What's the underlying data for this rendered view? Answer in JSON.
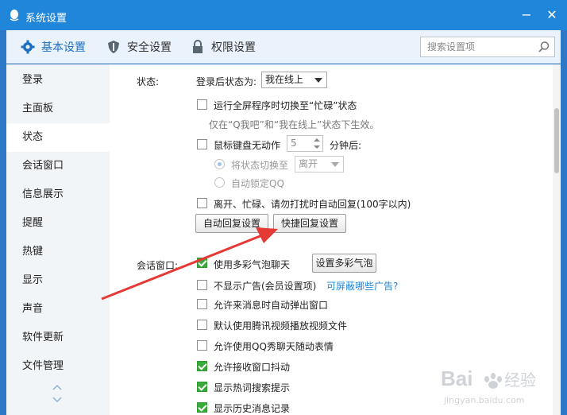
{
  "window": {
    "title": "系统设置",
    "minimize_glyph": "−",
    "close_glyph": "✕"
  },
  "tabs": [
    {
      "label": "基本设置",
      "icon": "gear-icon"
    },
    {
      "label": "安全设置",
      "icon": "shield-icon"
    },
    {
      "label": "权限设置",
      "icon": "lock-icon"
    }
  ],
  "search": {
    "placeholder": "搜索设置项"
  },
  "sidebar": {
    "items": [
      {
        "label": "登录"
      },
      {
        "label": "主面板"
      },
      {
        "label": "状态"
      },
      {
        "label": "会话窗口"
      },
      {
        "label": "信息展示"
      },
      {
        "label": "提醒"
      },
      {
        "label": "热键"
      },
      {
        "label": "显示"
      },
      {
        "label": "声音"
      },
      {
        "label": "软件更新"
      },
      {
        "label": "文件管理"
      }
    ],
    "active": "状态"
  },
  "status_section": {
    "label": "状态:",
    "login_status_label": "登录后状态为:",
    "login_status_value": "我在线上",
    "fullscreen_busy": {
      "label": "运行全屏程序时切换至“忙碌”状态",
      "checked": false
    },
    "fullscreen_hint": "仅在“Q我吧”和“我在线上”状态下生效。",
    "idle": {
      "label": "鼠标键盘无动作",
      "minutes": "5",
      "suffix": "分钟后:",
      "checked": false
    },
    "switch_to": {
      "label": "将状态切换至",
      "value": "离开",
      "selected": true
    },
    "auto_lock": {
      "label": "自动锁定QQ",
      "selected": false
    },
    "auto_reply": {
      "label": "离开、忙碌、请勿打扰时自动回复(100字以内)",
      "checked": false
    },
    "auto_reply_button": "自动回复设置",
    "quick_reply_button": "快捷回复设置"
  },
  "chat_section": {
    "label": "会话窗口:",
    "bubble": {
      "label": "使用多彩气泡聊天",
      "checked": true,
      "button": "设置多彩气泡"
    },
    "no_ads": {
      "label": "不显示广告(会员设置项)",
      "checked": false,
      "link": "可屏蔽哪些广告?"
    },
    "options": [
      {
        "label": "允许来消息时自动弹出窗口",
        "checked": false
      },
      {
        "label": "默认使用腾讯视频播放视频文件",
        "checked": false
      },
      {
        "label": "允许使用QQ秀聊天随动表情",
        "checked": false
      },
      {
        "label": "允许接收窗口抖动",
        "checked": true
      },
      {
        "label": "显示热词搜索提示",
        "checked": true
      },
      {
        "label": "显示历史消息记录",
        "checked": true
      }
    ]
  },
  "watermark": {
    "brand": "Bai",
    "brand2": "经验",
    "url": "jingyan.baidu.com"
  },
  "colors": {
    "titlebar": "#1f86da",
    "accent": "#1e6fbf",
    "check": "#3aaa3a",
    "arrow": "#e53935"
  }
}
